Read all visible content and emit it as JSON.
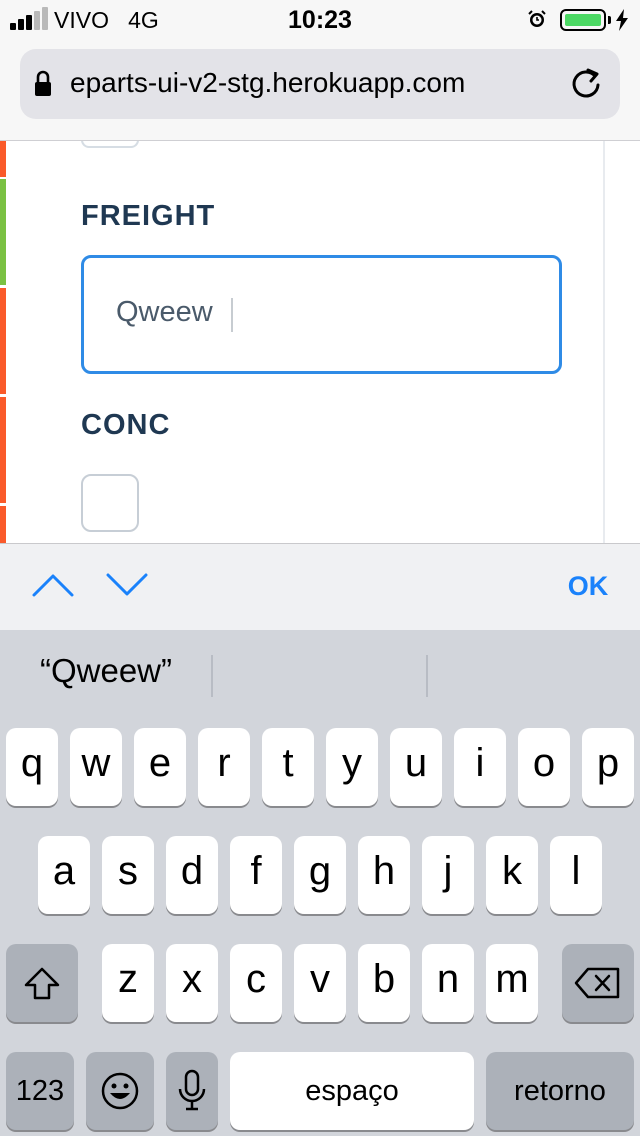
{
  "status_bar": {
    "carrier": "VIVO",
    "network": "4G",
    "time": "10:23"
  },
  "browser": {
    "url": "eparts-ui-v2-stg.herokuapp.com"
  },
  "form": {
    "freight_label": "FREIGHT",
    "freight_value": "Qweew",
    "conc_label": "CONC",
    "conc_checked": false
  },
  "accessory_bar": {
    "done_label": "OK"
  },
  "keyboard": {
    "suggestions": [
      "“Qweew”",
      "",
      ""
    ],
    "row1": [
      "q",
      "w",
      "e",
      "r",
      "t",
      "y",
      "u",
      "i",
      "o",
      "p"
    ],
    "row2": [
      "a",
      "s",
      "d",
      "f",
      "g",
      "h",
      "j",
      "k",
      "l"
    ],
    "row3": [
      "z",
      "x",
      "c",
      "v",
      "b",
      "n",
      "m"
    ],
    "numbers_label": "123",
    "space_label": "espaço",
    "return_label": "retorno"
  },
  "colors": {
    "accent": "#1a82fb",
    "label": "#1f3852",
    "input_border": "#2f8be6",
    "stripe_orange": "#fa5a2a",
    "stripe_green": "#7ac143"
  }
}
